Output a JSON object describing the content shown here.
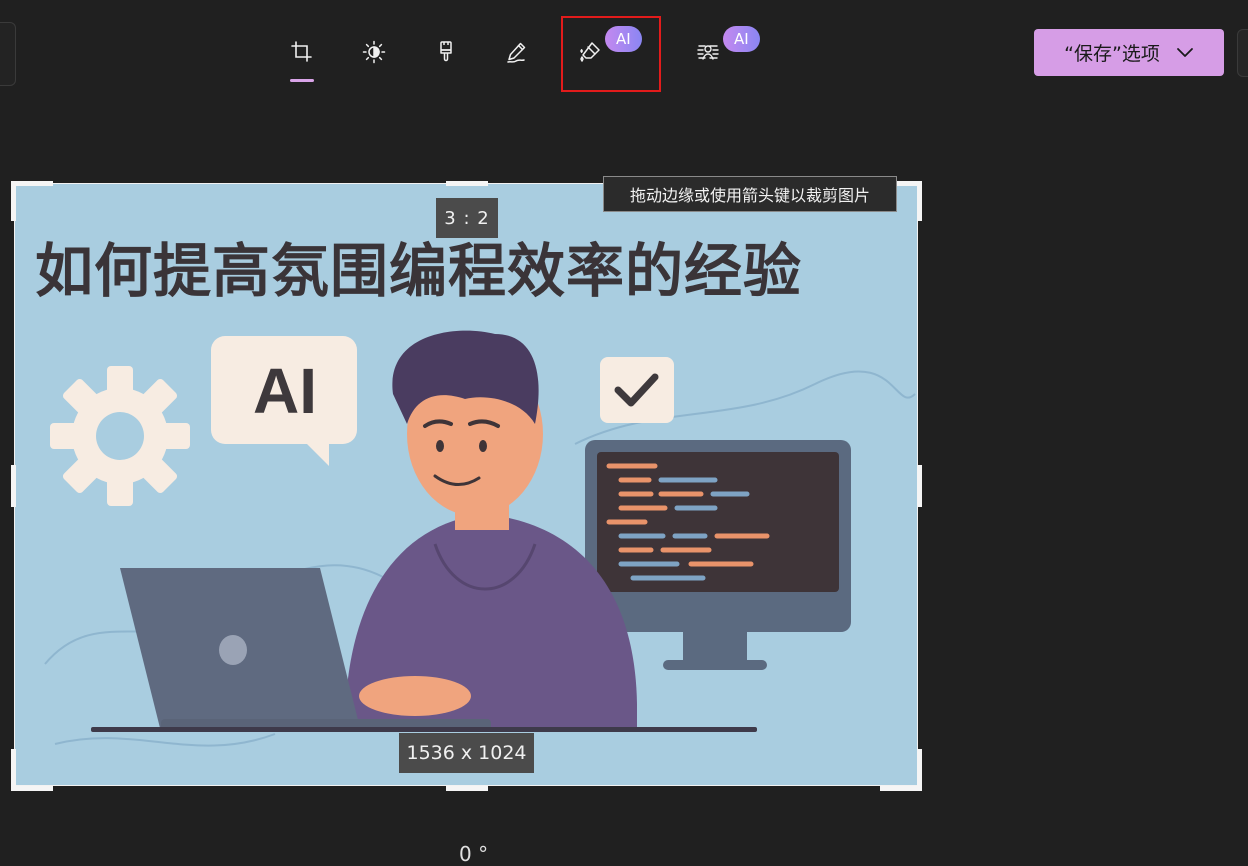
{
  "toolbar": {
    "tools": [
      {
        "name": "crop",
        "icon": "crop-icon",
        "active": true
      },
      {
        "name": "adjust",
        "icon": "brightness-icon"
      },
      {
        "name": "filter",
        "icon": "brush-icon"
      },
      {
        "name": "markup",
        "icon": "pen-icon"
      },
      {
        "name": "erase",
        "icon": "eraser-sparkle-icon",
        "badge": "AI"
      },
      {
        "name": "background",
        "icon": "background-blur-icon",
        "badge": "AI"
      }
    ],
    "ai_badge_erase": "AI",
    "ai_badge_background": "AI",
    "save_label": "“保存”选项",
    "save_icon": "chevron-down-icon"
  },
  "canvas": {
    "image_title": "如何提高氛围编程效率的经验",
    "image_ai_text": "AI",
    "aspect_ratio": "3 : 2",
    "dimensions": "1536 x 1024",
    "tooltip": "拖动边缘或使用箭头键以裁剪图片",
    "rotation": "0 °"
  },
  "colors": {
    "background": "#202020",
    "accent": "#d69de6",
    "highlight": "#e21b1b",
    "image_bg": "#a9cde0"
  }
}
